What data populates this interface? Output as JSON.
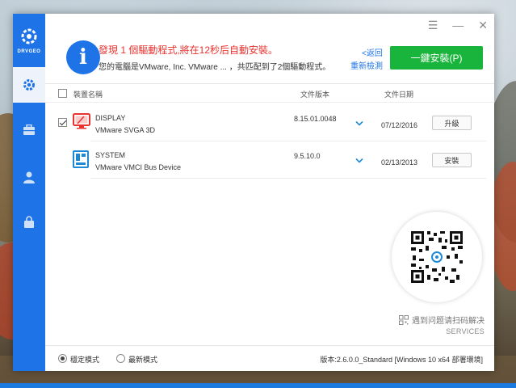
{
  "window_controls": {
    "menu": "☰",
    "minimize": "—",
    "close": "✕"
  },
  "app": {
    "logo_text": "DRVGEO"
  },
  "sidebar": {
    "items": [
      {
        "name": "settings-gear-icon",
        "active": true
      },
      {
        "name": "toolbox-icon",
        "active": false
      },
      {
        "name": "user-icon",
        "active": false
      },
      {
        "name": "lock-bag-icon",
        "active": false
      }
    ]
  },
  "header": {
    "title": "發現 1 個驅動程式,將在12秒后自動安裝。",
    "subtitle": "您的電腦是VMware, Inc. VMware ... ，共匹配到了2個驅動程式。",
    "back_link": "<返回",
    "rescan_link": "重新檢測",
    "install_button": "一鍵安裝(P)"
  },
  "table": {
    "headers": {
      "name": "裝置名稱",
      "version": "文件版本",
      "date": "文件日期"
    },
    "rows": [
      {
        "category": "DISPLAY",
        "device": "VMware SVGA 3D",
        "version": "8.15.01.0048",
        "date": "07/12/2016",
        "action": "升級",
        "checked": true
      },
      {
        "category": "SYSTEM",
        "device": "VMware VMCI Bus Device",
        "version": "9.5.10.0",
        "date": "02/13/2013",
        "action": "安裝",
        "checked": false
      }
    ]
  },
  "service": {
    "line1": "遇到问题请扫码解决",
    "line2": "SERVICES"
  },
  "footer": {
    "mode_stable": "穩定模式",
    "mode_latest": "最新模式",
    "version": "版本:2.6.0.0_Standard [Windows 10 x64 部署環境]"
  },
  "colors": {
    "accent": "#1e74e6",
    "install_green": "#19b43c",
    "alert_red": "#e8332f"
  }
}
